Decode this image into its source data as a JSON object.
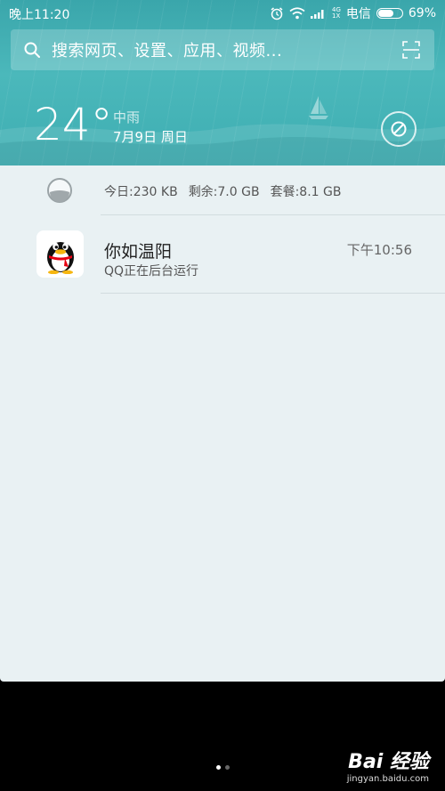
{
  "status_bar": {
    "time": "晚上11:20",
    "network_top": "4G",
    "network_bottom": "1X",
    "carrier": "电信",
    "battery_percent": "69%",
    "battery_level": 0.69,
    "icons": [
      "alarm-icon",
      "wifi-icon",
      "signal-icon",
      "battery-icon"
    ]
  },
  "search": {
    "placeholder": "搜索网页、设置、应用、视频..."
  },
  "weather": {
    "temperature": "24°",
    "condition": "中雨",
    "date": "7月9日 周日"
  },
  "data_usage": {
    "today": "今日:230 KB",
    "remaining": "剩余:7.0 GB",
    "plan": "套餐:8.1 GB"
  },
  "notifications": [
    {
      "app": "QQ",
      "title": "你如温阳",
      "time": "下午10:56",
      "body": "QQ正在后台运行"
    }
  ],
  "watermark": {
    "logo": "Bai 经验",
    "site": "jingyan.baidu.com"
  },
  "colors": {
    "panel_teal": "#3aa6ab",
    "notification_bg": "#e9f1f3"
  }
}
